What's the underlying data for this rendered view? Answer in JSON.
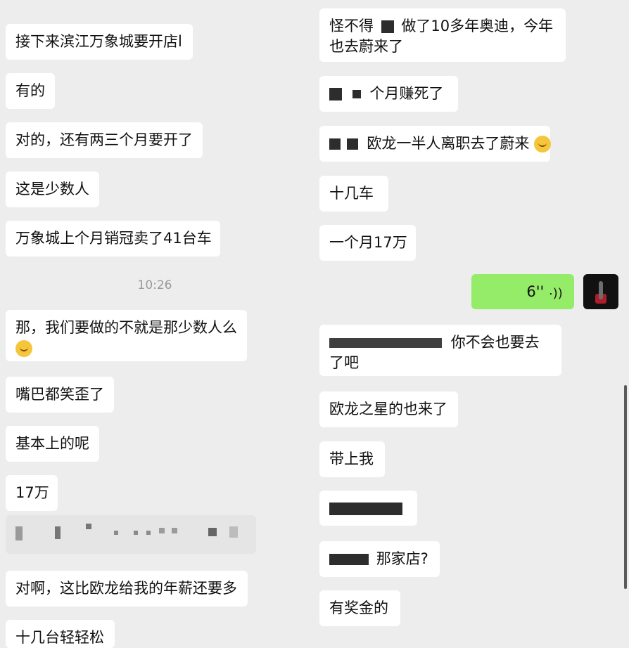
{
  "left": {
    "messages": [
      "接下来滨江万象城要开店l",
      "有的",
      "对的，还有两三个月要开了",
      "这是少数人",
      "万象城上个月销冠卖了41台车"
    ],
    "timestamp": "10:26",
    "after": [
      "那，我们要做的不就是那少数人么",
      "嘴巴都笑歪了",
      "基本上的呢",
      "17万",
      "对啊，这比欧龙给我的年薪还要多",
      "十几台轻轻松"
    ]
  },
  "right": {
    "messages": [
      "怪不得",
      "做了10多年奥迪，今年也去蔚来了",
      "个月赚死了",
      "欧龙一半人离职去了蔚来",
      "十几车",
      "一个月17万"
    ],
    "voice": "6''",
    "after": [
      "你不会也要去了吧",
      "欧龙之星的也来了",
      "带上我",
      "那家店?",
      "有奖金的"
    ]
  },
  "icons": {
    "laugh": "laughing-emoji",
    "dizzy": "dizzy-emoji",
    "voice": "voice-wave-icon",
    "avatar": "user-avatar"
  }
}
